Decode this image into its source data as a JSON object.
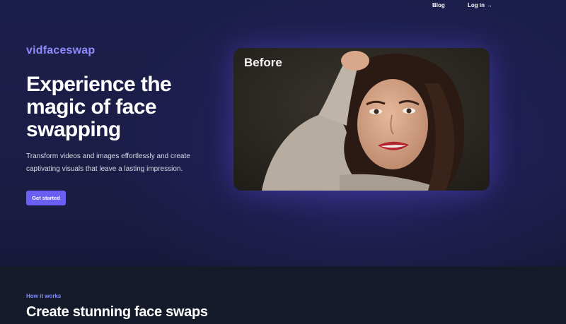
{
  "nav": {
    "blog_label": "Blog",
    "login_label": "Log in",
    "login_icon": "arrow-right-icon"
  },
  "hero": {
    "brand": "vidfaceswap",
    "headline": "Experience the magic of face swapping",
    "subtext": "Transform videos and images effortlessly and create captivating visuals that leave a lasting impression.",
    "cta_label": "Get started",
    "media_label": "Before"
  },
  "how_it_works": {
    "eyebrow": "How it works",
    "title": "Create stunning face swaps"
  },
  "colors": {
    "accent": "#6a5ff2",
    "brand": "#8f8bff",
    "eyebrow": "#7f8cff",
    "hero_bg": "#1c1e4a",
    "section_bg": "#151a2a"
  }
}
